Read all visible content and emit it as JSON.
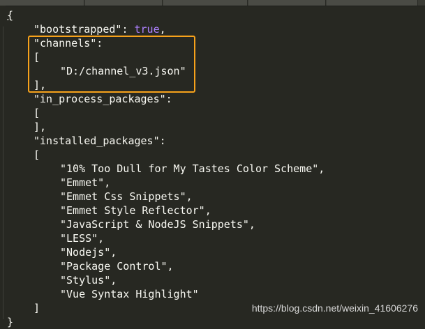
{
  "editor": {
    "lines": {
      "l0": "{",
      "l1_key": "\"bootstrapped\"",
      "l1_sep": ": ",
      "l1_val": "true",
      "l1_end": ",",
      "l2": "\"channels\":",
      "l3": "[",
      "l4": "\"D:/channel_v3.json\"",
      "l5": "],",
      "l6": "\"in_process_packages\":",
      "l7": "[",
      "l8": "],",
      "l9": "\"installed_packages\":",
      "l10": "[",
      "packages": [
        "\"10% Too Dull for My Tastes Color Scheme\",",
        "\"Emmet\",",
        "\"Emmet Css Snippets\",",
        "\"Emmet Style Reflector\",",
        "\"JavaScript & NodeJS Snippets\",",
        "\"LESS\",",
        "\"Nodejs\",",
        "\"Package Control\",",
        "\"Stylus\",",
        "\"Vue Syntax Highlight\""
      ],
      "l21": "]",
      "l22": "}"
    }
  },
  "watermark": "https://blog.csdn.net/weixin_41606276",
  "colors": {
    "background": "#272822",
    "text": "#f8f8f2",
    "boolean": "#ae81ff",
    "highlight_box": "#f7a21b"
  }
}
